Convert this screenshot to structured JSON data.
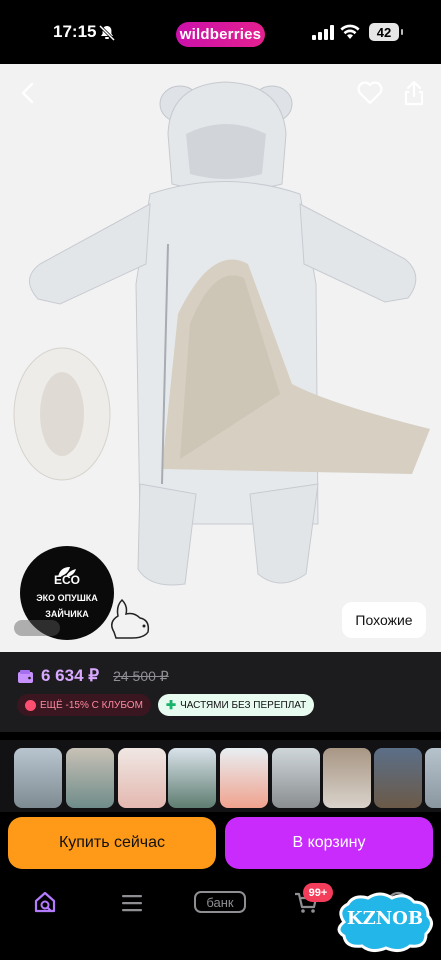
{
  "status_bar": {
    "time": "17:15",
    "brand": "wildberries",
    "battery": "42"
  },
  "product_image": {
    "eco_badge": {
      "logo": "ECO",
      "line1": "ЭКО ОПУШКА",
      "line2": "ЗАЙЧИКА"
    },
    "similar_label": "Похожие"
  },
  "price": {
    "current": "6 634 ₽",
    "old": "24 500 ₽",
    "club_tag": "ЕЩЁ -15% С КЛУБОМ",
    "parts_tag": "ЧАСТЯМИ БЕЗ ПЕРЕПЛАТ"
  },
  "actions": {
    "buy_now": "Купить сейчас",
    "add_to_cart": "В корзину"
  },
  "bottom_nav": {
    "bank": "банк",
    "cart_badge": "99+"
  },
  "watermark": "KZNOB",
  "colors": {
    "brand": "#cb11ab",
    "buy_now": "#ff9a19",
    "add_to_cart": "#c92bfc",
    "price": "#d8a8ff",
    "badge": "#f33d5a"
  },
  "icons": [
    "bell-mute-icon",
    "signal-icon",
    "wifi-icon",
    "back-icon",
    "heart-icon",
    "share-icon",
    "wallet-icon",
    "search-home-icon",
    "menu-icon",
    "cart-icon",
    "profile-icon"
  ]
}
